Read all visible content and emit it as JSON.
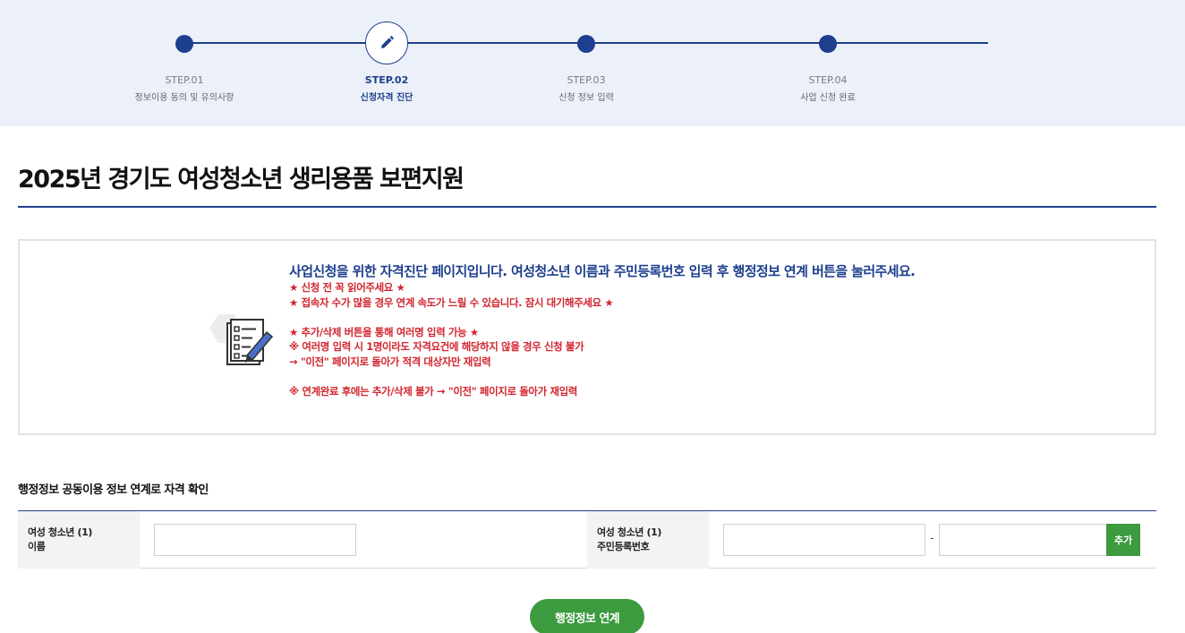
{
  "stepper": {
    "steps": [
      {
        "num": "STEP.01",
        "label": "정보이용 동의 및 유의사항",
        "active": false
      },
      {
        "num": "STEP.02",
        "label": "신청자격 진단",
        "active": true
      },
      {
        "num": "STEP.03",
        "label": "신청 정보 입력",
        "active": false
      },
      {
        "num": "STEP.04",
        "label": "사업 신청 완료",
        "active": false
      }
    ],
    "active_icon": "pencil-icon"
  },
  "page": {
    "title": "2025년 경기도 여성청소년 생리용품 보편지원"
  },
  "notice": {
    "icon": "checklist-document-icon",
    "lead": "사업신청을 위한 자격진단 페이지입니다. 여성청소년 이름과 주민등록번호 입력 후 행정정보 연계 버튼을 눌러주세요.",
    "lines": [
      "★ 신청 전 꼭 읽어주세요 ★",
      "★ 접속자 수가 많을 경우 연계 속도가 느릴 수 있습니다. 잠시 대기해주세요 ★",
      "",
      "★ 추가/삭제 버튼을 통해 여러명 입력 가능 ★",
      "※ 여러명 입력 시 1명이라도 자격요건에 해당하지 않을 경우 신청 불가",
      "→ \"이전\" 페이지로 돌아가 적격 대상자만 재입력",
      "",
      "※ 연계완료 후에는 추가/삭제 불가 → \"이전\" 페이지로 돌아가 재입력"
    ]
  },
  "form": {
    "section_title": "행정정보 공동이용 정보 연계로 자격 확인",
    "name_label_1": "여성 청소년 (1)",
    "name_label_2": "이름",
    "name_value": "",
    "rrn_label_1": "여성 청소년 (1)",
    "rrn_label_2": "주민등록번호",
    "rrn_front_value": "",
    "rrn_back_value": "",
    "dash": "-",
    "add_label": "추가",
    "submit_label": "행정정보 연계"
  },
  "colors": {
    "navy": "#1d3f8e",
    "stepper_bg": "#ecf0f8",
    "warning_red": "#d2262f",
    "green": "#3c9a3f"
  }
}
